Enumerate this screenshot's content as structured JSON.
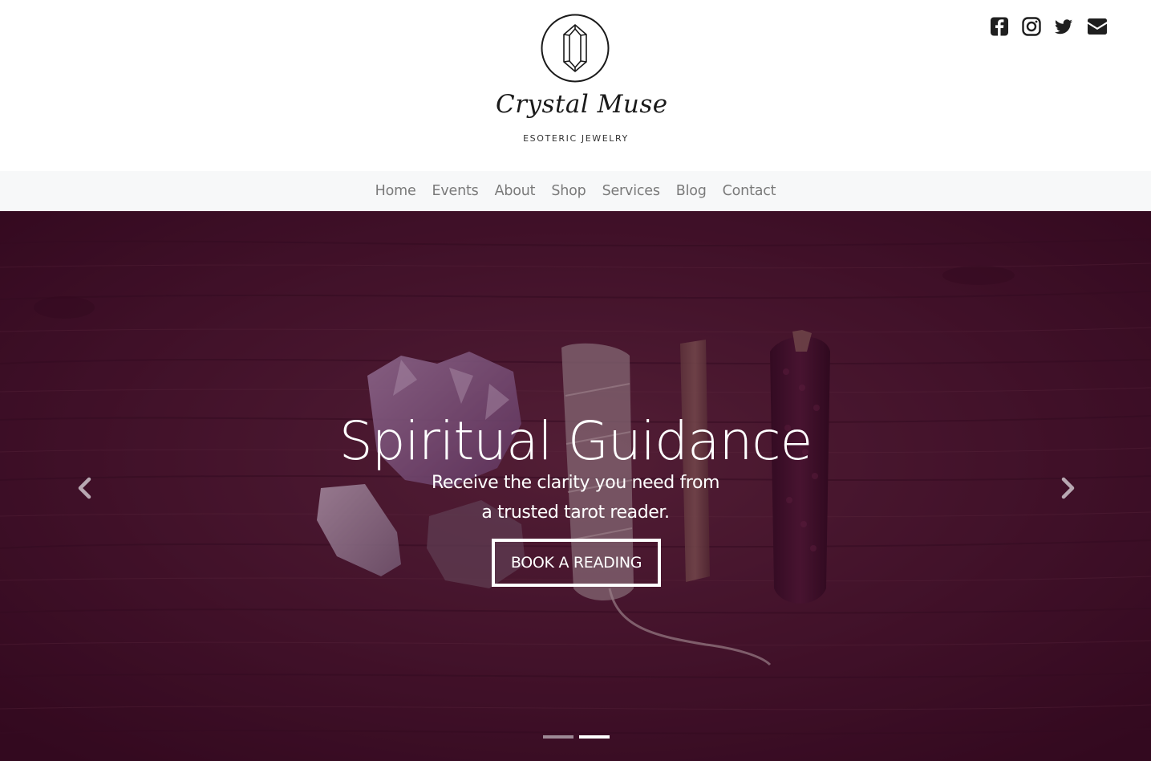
{
  "brand": {
    "name": "Crystal Muse",
    "tagline": "ESOTERIC JEWELRY"
  },
  "social": [
    {
      "icon": "facebook-icon",
      "name": "social-facebook"
    },
    {
      "icon": "instagram-icon",
      "name": "social-instagram"
    },
    {
      "icon": "twitter-icon",
      "name": "social-twitter"
    },
    {
      "icon": "envelope-icon",
      "name": "social-email"
    }
  ],
  "nav": {
    "items": [
      {
        "label": "Home"
      },
      {
        "label": "Events"
      },
      {
        "label": "About"
      },
      {
        "label": "Shop"
      },
      {
        "label": "Services"
      },
      {
        "label": "Blog"
      },
      {
        "label": "Contact"
      }
    ]
  },
  "hero": {
    "title": "Spiritual Guidance",
    "subtitle_line1": "Receive the clarity you need from",
    "subtitle_line2": "a trusted tarot reader.",
    "cta_label": "BOOK A READING",
    "prev_icon": "chevron-left-icon",
    "next_icon": "chevron-right-icon",
    "slides_total": 2,
    "active_slide": 2
  },
  "colors": {
    "nav_bg": "#f7f8f9",
    "nav_text": "#7a7a7a",
    "hero_tint": "#46082d",
    "icon_dark": "#1f1f1f",
    "indicator_active": "#ffffff",
    "indicator_inactive": "#9e8a96"
  }
}
